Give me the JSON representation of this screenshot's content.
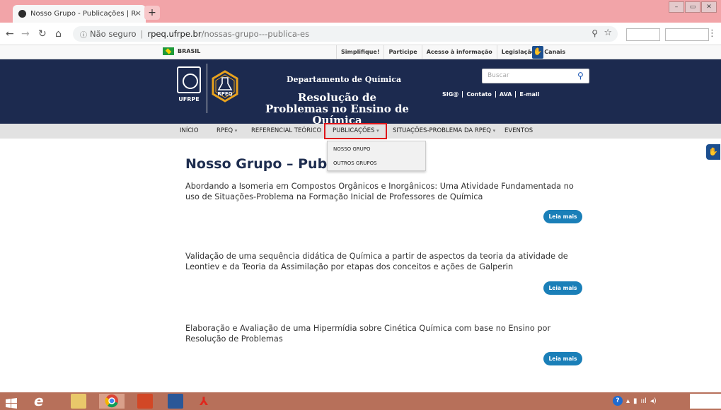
{
  "browser": {
    "tab_title": "Nosso Grupo - Publicações | Res",
    "tab_close": "×",
    "new_tab": "+",
    "security_label": "Não seguro",
    "url_host": "rpeq.ufrpe.br",
    "url_path": "/nossas-grupo---publica-es",
    "window_controls": [
      "–",
      "▭",
      "✕"
    ]
  },
  "govbar": {
    "brasil": "BRASIL",
    "links": [
      "Simplifique!",
      "Participe",
      "Acesso à informação",
      "Legislação",
      "Canais"
    ]
  },
  "header": {
    "ufrpe_label": "UFRPE",
    "rpeq_label": "RPEQ",
    "department": "Departamento de Química",
    "title": "Resolução de Problemas no Ensino de Química",
    "search_placeholder": "Buscar",
    "links": [
      "SIG@",
      "Contato",
      "AVA",
      "E-mail"
    ]
  },
  "nav": {
    "items": [
      "INÍCIO",
      "RPEQ",
      "REFERENCIAL TEÓRICO",
      "PUBLICAÇÕES",
      "SITUAÇÕES-PROBLEMA DA RPEQ",
      "EVENTOS"
    ],
    "dropdown": [
      "NOSSO GRUPO",
      "OUTROS GRUPOS"
    ]
  },
  "content": {
    "page_title": "Nosso Grupo – Publicações",
    "posts": [
      "Abordando a Isomeria em Compostos Orgânicos e Inorgânicos: Uma Atividade Fundamentada no uso de Situações-Problema na Formação Inicial de Professores de Química",
      "Validação de uma sequência didática de Química a partir de aspectos da teoria da atividade de Leontiev e da Teoria da Assimilação por etapas dos conceitos e ações de Galperin",
      "Elaboração e Avaliação de uma Hipermídia sobre Cinética Química com base no Ensino por Resolução de Problemas"
    ],
    "read_more": "Leia mais"
  }
}
